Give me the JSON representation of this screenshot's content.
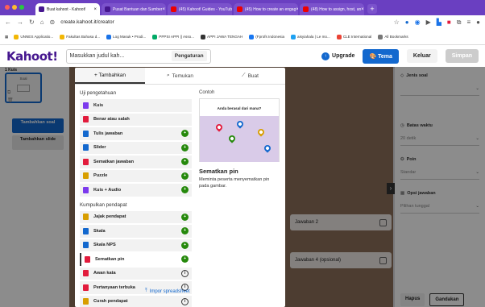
{
  "browser": {
    "tabs": [
      {
        "title": "Buat kahoot - Kahoot!",
        "active": true,
        "fav": "#46178f"
      },
      {
        "title": "Pusat Bantuan dan Sumber",
        "active": false,
        "fav": "#46178f"
      },
      {
        "title": "(45) Kahoot! Guides - YouTube",
        "active": false,
        "fav": "#e00"
      },
      {
        "title": "(45) How to create an engag",
        "active": false,
        "fav": "#e00"
      },
      {
        "title": "(48) How to assign, host, an",
        "active": false,
        "fav": "#e00"
      }
    ],
    "new_tab": "+",
    "url": "create.kahoot.it/creator",
    "bookmarks": [
      {
        "label": "UNNES Applicatio...",
        "color": "#f2b705"
      },
      {
        "label": "Fakultas Bahasa d...",
        "color": "#f2b705"
      },
      {
        "label": "Log Masuk • Prodi...",
        "color": "#1a73e8"
      },
      {
        "label": "PPPSI APPI || Asso...",
        "color": "#0a6"
      },
      {
        "label": "APPI JAWA TENGAH",
        "color": "#333"
      },
      {
        "label": "(Fprofs Indonesia",
        "color": "#1877f2"
      },
      {
        "label": "aisyiahala | Le mo...",
        "color": "#1da1f2"
      },
      {
        "label": "CLE International",
        "color": "#ea4335"
      },
      {
        "label": "All Bookmarks",
        "color": "#777"
      }
    ]
  },
  "header": {
    "logo": "Kahoot!",
    "title_placeholder": "Masukkan judul kah...",
    "settings": "Pengaturan",
    "upgrade": "Upgrade",
    "theme": "Tema",
    "exit": "Keluar",
    "save": "Simpan"
  },
  "left": {
    "slide_label": "1  Kuis",
    "slide_title": "Soal",
    "add_question": "Tambahkan soal",
    "add_slide": "Tambahkan slide"
  },
  "canvas": {
    "answer2": "Jawaban 2",
    "answer4": "Jawaban 4 (opsional)"
  },
  "right": {
    "question_type": "Jenis soal",
    "time_limit": "Batas waktu",
    "time_value": "20 detik",
    "points": "Poin",
    "points_value": "Standar",
    "answer_options": "Opsi jawaban",
    "answer_value": "Pilihan tunggal",
    "discard": "Hapus",
    "done": "Gandakan"
  },
  "modal": {
    "tabs": [
      "+ Tambahkan",
      "Temukan",
      "Buat"
    ],
    "section_knowledge": "Uji pengetahuan",
    "knowledge": [
      {
        "label": "Kuis",
        "color": "#7c3aed",
        "mark": ""
      },
      {
        "label": "Benar atau salah",
        "color": "#e21b3c",
        "mark": ""
      },
      {
        "label": "Tulis jawaban",
        "color": "#1368ce",
        "mark": "+"
      },
      {
        "label": "Slider",
        "color": "#1368ce",
        "mark": "+"
      },
      {
        "label": "Sematkan jawaban",
        "color": "#e21b3c",
        "mark": "+"
      },
      {
        "label": "Puzzle",
        "color": "#d89e00",
        "mark": "+"
      },
      {
        "label": "Kuis + Audio",
        "color": "#7c3aed",
        "mark": "+"
      }
    ],
    "section_opinion": "Kumpulkan pendapat",
    "opinion": [
      {
        "label": "Jajak pendapat",
        "color": "#d89e00",
        "mark": "+"
      },
      {
        "label": "Skala",
        "color": "#1368ce",
        "mark": "+"
      },
      {
        "label": "Skala NPS",
        "color": "#1368ce",
        "mark": "+"
      },
      {
        "label": "Sematkan pin",
        "color": "#e21b3c",
        "mark": "+"
      },
      {
        "label": "Awan kata",
        "color": "#e21b3c",
        "mark": "i"
      },
      {
        "label": "Pertanyaan terbuka",
        "color": "#e21b3c",
        "mark": "i"
      },
      {
        "label": "Curah pendapat",
        "color": "#d89e00",
        "mark": "i"
      }
    ],
    "example_label": "Contoh",
    "example_question": "Anda berasal dari mana?",
    "selected_title": "Sematkan pin",
    "selected_desc": "Meminta peserta menyematkan pin pada gambar.",
    "import": "Impor spreadsheet"
  }
}
